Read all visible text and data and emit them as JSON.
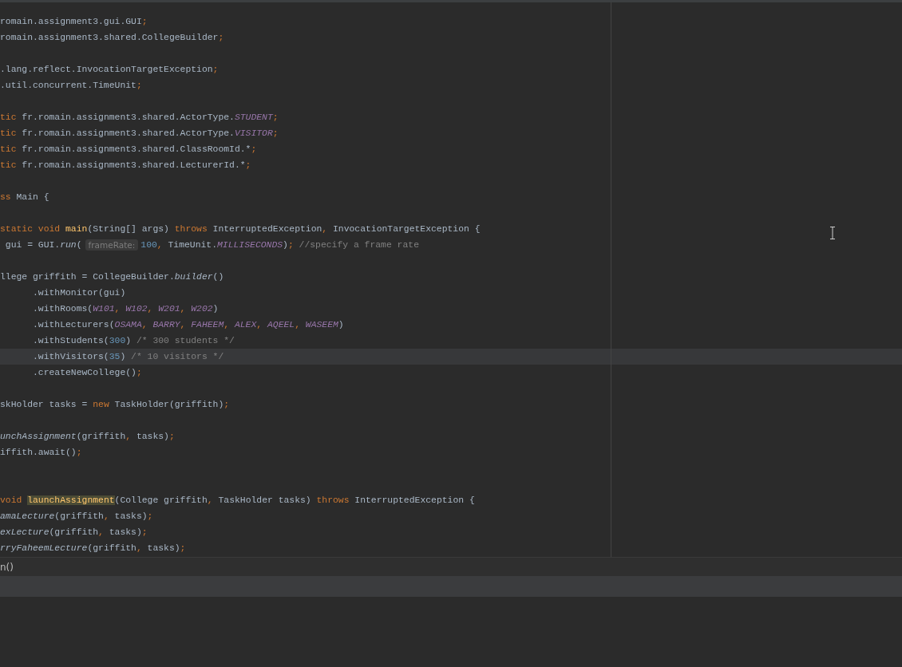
{
  "editor": {
    "lines": [
      {
        "current": false,
        "tokens": [
          {
            "kind": "plain",
            "text": "romain.assignment3.gui.GUI"
          },
          {
            "kind": "keyword",
            "text": ";"
          }
        ]
      },
      {
        "current": false,
        "tokens": [
          {
            "kind": "plain",
            "text": "romain.assignment3.shared.CollegeBuilder"
          },
          {
            "kind": "keyword",
            "text": ";"
          }
        ]
      },
      {
        "current": false
      },
      {
        "current": false,
        "tokens": [
          {
            "kind": "plain",
            "text": ".lang.reflect.InvocationTargetException"
          },
          {
            "kind": "keyword",
            "text": ";"
          }
        ]
      },
      {
        "current": false,
        "tokens": [
          {
            "kind": "plain",
            "text": ".util.concurrent.TimeUnit"
          },
          {
            "kind": "keyword",
            "text": ";"
          }
        ]
      },
      {
        "current": false
      },
      {
        "current": false,
        "tokens": [
          {
            "kind": "keyword",
            "text": "tic"
          },
          {
            "kind": "plain",
            "text": " fr.romain.assignment3.shared.ActorType."
          },
          {
            "kind": "constant",
            "text": "STUDENT"
          },
          {
            "kind": "keyword",
            "text": ";"
          }
        ]
      },
      {
        "current": false,
        "tokens": [
          {
            "kind": "keyword",
            "text": "tic"
          },
          {
            "kind": "plain",
            "text": " fr.romain.assignment3.shared.ActorType."
          },
          {
            "kind": "constant",
            "text": "VISITOR"
          },
          {
            "kind": "keyword",
            "text": ";"
          }
        ]
      },
      {
        "current": false,
        "tokens": [
          {
            "kind": "keyword",
            "text": "tic"
          },
          {
            "kind": "plain",
            "text": " fr.romain.assignment3.shared.ClassRoomId.*"
          },
          {
            "kind": "keyword",
            "text": ";"
          }
        ]
      },
      {
        "current": false,
        "tokens": [
          {
            "kind": "keyword",
            "text": "tic"
          },
          {
            "kind": "plain",
            "text": " fr.romain.assignment3.shared.LecturerId.*"
          },
          {
            "kind": "keyword",
            "text": ";"
          }
        ]
      },
      {
        "current": false
      },
      {
        "current": false,
        "tokens": [
          {
            "kind": "keyword",
            "text": "ss"
          },
          {
            "kind": "plain",
            "text": " Main {"
          }
        ]
      },
      {
        "current": false
      },
      {
        "current": false,
        "tokens": [
          {
            "kind": "keyword",
            "text": "static void "
          },
          {
            "kind": "decl",
            "text": "main"
          },
          {
            "kind": "plain",
            "text": "(String[] args) "
          },
          {
            "kind": "keyword",
            "text": "throws"
          },
          {
            "kind": "plain",
            "text": " InterruptedException"
          },
          {
            "kind": "keyword",
            "text": ","
          },
          {
            "kind": "plain",
            "text": " InvocationTargetException {"
          }
        ]
      },
      {
        "current": false,
        "tokens": [
          {
            "kind": "plain",
            "text": " gui = GUI."
          },
          {
            "kind": "italic",
            "text": "run"
          },
          {
            "kind": "plain",
            "text": "("
          },
          {
            "kind": "hint",
            "text": "frameRate:"
          },
          {
            "kind": "number",
            "text": "100"
          },
          {
            "kind": "keyword",
            "text": ","
          },
          {
            "kind": "plain",
            "text": " TimeUnit."
          },
          {
            "kind": "constant",
            "text": "MILLISECONDS"
          },
          {
            "kind": "plain",
            "text": ")"
          },
          {
            "kind": "keyword",
            "text": ";"
          },
          {
            "kind": "comment",
            "text": " //specify a frame rate"
          }
        ]
      },
      {
        "current": false
      },
      {
        "current": false,
        "tokens": [
          {
            "kind": "plain",
            "text": "llege griffith = CollegeBuilder."
          },
          {
            "kind": "italic",
            "text": "builder"
          },
          {
            "kind": "plain",
            "text": "()"
          }
        ]
      },
      {
        "current": false,
        "tokens": [
          {
            "kind": "plain",
            "text": "      .withMonitor(gui)"
          }
        ]
      },
      {
        "current": false,
        "tokens": [
          {
            "kind": "plain",
            "text": "      .withRooms("
          },
          {
            "kind": "constant",
            "text": "W101"
          },
          {
            "kind": "keyword",
            "text": ", "
          },
          {
            "kind": "constant",
            "text": "W102"
          },
          {
            "kind": "keyword",
            "text": ", "
          },
          {
            "kind": "constant",
            "text": "W201"
          },
          {
            "kind": "keyword",
            "text": ", "
          },
          {
            "kind": "constant",
            "text": "W202"
          },
          {
            "kind": "plain",
            "text": ")"
          }
        ]
      },
      {
        "current": false,
        "tokens": [
          {
            "kind": "plain",
            "text": "      .withLecturers("
          },
          {
            "kind": "constant",
            "text": "OSAMA"
          },
          {
            "kind": "keyword",
            "text": ", "
          },
          {
            "kind": "constant",
            "text": "BARRY"
          },
          {
            "kind": "keyword",
            "text": ", "
          },
          {
            "kind": "constant",
            "text": "FAHEEM"
          },
          {
            "kind": "keyword",
            "text": ", "
          },
          {
            "kind": "constant",
            "text": "ALEX"
          },
          {
            "kind": "keyword",
            "text": ", "
          },
          {
            "kind": "constant",
            "text": "AQEEL"
          },
          {
            "kind": "keyword",
            "text": ", "
          },
          {
            "kind": "constant",
            "text": "WASEEM"
          },
          {
            "kind": "plain",
            "text": ")"
          }
        ]
      },
      {
        "current": false,
        "tokens": [
          {
            "kind": "plain",
            "text": "      .withStudents("
          },
          {
            "kind": "number",
            "text": "300"
          },
          {
            "kind": "plain",
            "text": ") "
          },
          {
            "kind": "comment",
            "text": "/* 300 students */"
          }
        ]
      },
      {
        "current": true,
        "tokens": [
          {
            "kind": "plain",
            "text": "      .withVisitors("
          },
          {
            "kind": "number",
            "text": "35"
          },
          {
            "kind": "plain",
            "text": ") "
          },
          {
            "kind": "comment",
            "text": "/* 10 visitors */"
          }
        ]
      },
      {
        "current": false,
        "tokens": [
          {
            "kind": "plain",
            "text": "      .createNewCollege()"
          },
          {
            "kind": "keyword",
            "text": ";"
          }
        ]
      },
      {
        "current": false
      },
      {
        "current": false,
        "tokens": [
          {
            "kind": "plain",
            "text": "skHolder tasks = "
          },
          {
            "kind": "keyword",
            "text": "new"
          },
          {
            "kind": "plain",
            "text": " TaskHolder(griffith)"
          },
          {
            "kind": "keyword",
            "text": ";"
          }
        ]
      },
      {
        "current": false
      },
      {
        "current": false,
        "tokens": [
          {
            "kind": "italic",
            "text": "unchAssignment"
          },
          {
            "kind": "plain",
            "text": "(griffith"
          },
          {
            "kind": "keyword",
            "text": ","
          },
          {
            "kind": "plain",
            "text": " tasks)"
          },
          {
            "kind": "keyword",
            "text": ";"
          }
        ]
      },
      {
        "current": false,
        "tokens": [
          {
            "kind": "plain",
            "text": "iffith.await()"
          },
          {
            "kind": "keyword",
            "text": ";"
          }
        ]
      },
      {
        "current": false
      },
      {
        "current": false
      },
      {
        "current": false,
        "tokens": [
          {
            "kind": "keyword",
            "text": "void "
          },
          {
            "kind": "usage",
            "text": "launchAssignment"
          },
          {
            "kind": "plain",
            "text": "(College griffith"
          },
          {
            "kind": "keyword",
            "text": ","
          },
          {
            "kind": "plain",
            "text": " TaskHolder tasks) "
          },
          {
            "kind": "keyword",
            "text": "throws"
          },
          {
            "kind": "plain",
            "text": " InterruptedException {"
          }
        ]
      },
      {
        "current": false,
        "tokens": [
          {
            "kind": "italic",
            "text": "amaLecture"
          },
          {
            "kind": "plain",
            "text": "(griffith"
          },
          {
            "kind": "keyword",
            "text": ","
          },
          {
            "kind": "plain",
            "text": " tasks)"
          },
          {
            "kind": "keyword",
            "text": ";"
          }
        ]
      },
      {
        "current": false,
        "tokens": [
          {
            "kind": "italic",
            "text": "exLecture"
          },
          {
            "kind": "plain",
            "text": "(griffith"
          },
          {
            "kind": "keyword",
            "text": ","
          },
          {
            "kind": "plain",
            "text": " tasks)"
          },
          {
            "kind": "keyword",
            "text": ";"
          }
        ]
      },
      {
        "current": false,
        "tokens": [
          {
            "kind": "italic",
            "text": "rryFaheemLecture"
          },
          {
            "kind": "plain",
            "text": "(griffith"
          },
          {
            "kind": "keyword",
            "text": ","
          },
          {
            "kind": "plain",
            "text": " tasks)"
          },
          {
            "kind": "keyword",
            "text": ";"
          }
        ]
      }
    ]
  },
  "breadcrumbs": [
    "n()"
  ]
}
